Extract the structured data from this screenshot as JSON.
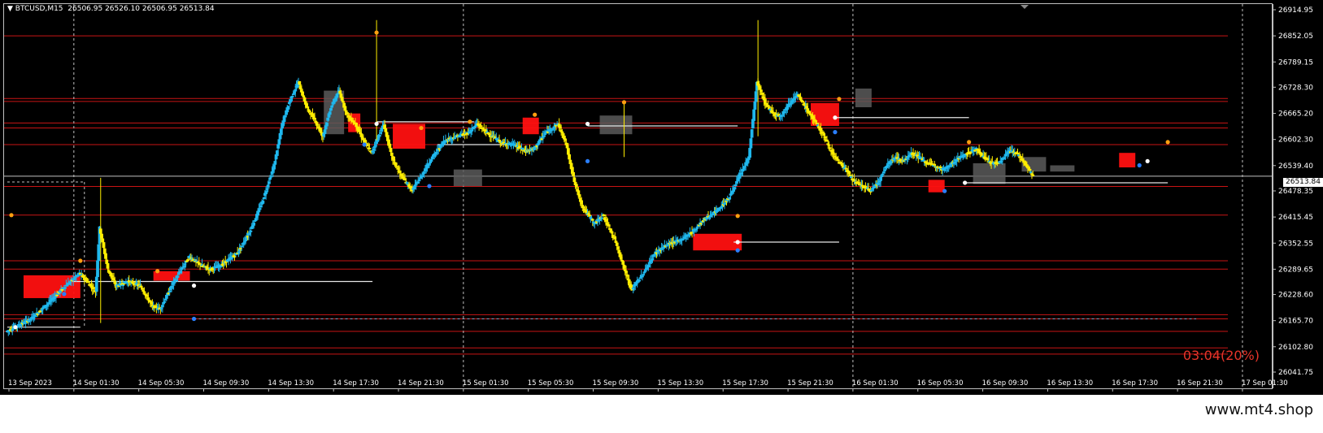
{
  "header": {
    "symbol": "BTCUSD,M15",
    "ohlc": "26506.95 26526.10 26506.95 26513.84"
  },
  "timer": "03:04(20%)",
  "brand": "www.mt4.shop",
  "last_price": "26513.84",
  "colors": {
    "background": "#000000",
    "bull": "#1fb8ee",
    "bear": "#ffee00",
    "level_line": "#c81414",
    "zone_red": "#ff1010",
    "zone_gray": "#5a5a5a",
    "grid": "#bfbfbf",
    "axis_text": "#ffffff",
    "timer": "#e8352a",
    "dot_orange": "#ff9f10",
    "dot_blue": "#2a7fff"
  },
  "chart_data": {
    "type": "candlestick",
    "title": "BTCUSD,M15",
    "ylim": [
      26041.75,
      26914.95
    ],
    "y_ticks": [
      "26914.95",
      "26852.05",
      "26789.15",
      "26728.30",
      "26665.20",
      "26602.30",
      "26539.40",
      "26478.35",
      "26415.45",
      "26352.55",
      "26289.65",
      "26228.60",
      "26165.70",
      "26102.80",
      "26041.75"
    ],
    "x_ticks": [
      "13 Sep 2023",
      "14 Sep 01:30",
      "14 Sep 05:30",
      "14 Sep 09:30",
      "14 Sep 13:30",
      "14 Sep 17:30",
      "14 Sep 21:30",
      "15 Sep 01:30",
      "15 Sep 05:30",
      "15 Sep 09:30",
      "15 Sep 13:30",
      "15 Sep 17:30",
      "15 Sep 21:30",
      "16 Sep 01:30",
      "16 Sep 05:30",
      "16 Sep 09:30",
      "16 Sep 13:30",
      "16 Sep 17:30",
      "16 Sep 21:30",
      "17 Sep 01:30"
    ],
    "grid_vertical_at": [
      "14 Sep 01:30",
      "15 Sep 01:30",
      "16 Sep 01:30",
      "17 Sep 01:30"
    ],
    "last_price": 26513.84,
    "price_path": [
      [
        0,
        26140
      ],
      [
        6,
        26170
      ],
      [
        10,
        26205
      ],
      [
        14,
        26245
      ],
      [
        18,
        26280
      ],
      [
        20,
        26260
      ],
      [
        22,
        26235
      ],
      [
        23,
        26390
      ],
      [
        25,
        26290
      ],
      [
        27,
        26250
      ],
      [
        30,
        26260
      ],
      [
        33,
        26250
      ],
      [
        36,
        26200
      ],
      [
        38,
        26195
      ],
      [
        41,
        26255
      ],
      [
        45,
        26320
      ],
      [
        48,
        26300
      ],
      [
        50,
        26290
      ],
      [
        53,
        26300
      ],
      [
        57,
        26330
      ],
      [
        60,
        26380
      ],
      [
        63,
        26450
      ],
      [
        66,
        26540
      ],
      [
        68,
        26640
      ],
      [
        70,
        26700
      ],
      [
        72,
        26740
      ],
      [
        74,
        26680
      ],
      [
        76,
        26650
      ],
      [
        78,
        26610
      ],
      [
        80,
        26680
      ],
      [
        82,
        26720
      ],
      [
        84,
        26660
      ],
      [
        86,
        26640
      ],
      [
        88,
        26600
      ],
      [
        90,
        26570
      ],
      [
        93,
        26640
      ],
      [
        95,
        26560
      ],
      [
        97,
        26520
      ],
      [
        100,
        26480
      ],
      [
        102,
        26510
      ],
      [
        105,
        26560
      ],
      [
        108,
        26600
      ],
      [
        111,
        26610
      ],
      [
        114,
        26620
      ],
      [
        116,
        26640
      ],
      [
        119,
        26615
      ],
      [
        122,
        26595
      ],
      [
        125,
        26590
      ],
      [
        128,
        26575
      ],
      [
        130,
        26580
      ],
      [
        133,
        26620
      ],
      [
        136,
        26640
      ],
      [
        138,
        26590
      ],
      [
        140,
        26500
      ],
      [
        142,
        26440
      ],
      [
        145,
        26400
      ],
      [
        147,
        26420
      ],
      [
        150,
        26360
      ],
      [
        152,
        26300
      ],
      [
        154,
        26240
      ],
      [
        157,
        26280
      ],
      [
        160,
        26330
      ],
      [
        163,
        26350
      ],
      [
        166,
        26360
      ],
      [
        169,
        26380
      ],
      [
        172,
        26410
      ],
      [
        175,
        26430
      ],
      [
        178,
        26460
      ],
      [
        181,
        26520
      ],
      [
        183,
        26560
      ],
      [
        185,
        26740
      ],
      [
        187,
        26690
      ],
      [
        189,
        26665
      ],
      [
        191,
        26660
      ],
      [
        193,
        26690
      ],
      [
        195,
        26710
      ],
      [
        197,
        26680
      ],
      [
        199,
        26650
      ],
      [
        201,
        26620
      ],
      [
        203,
        26580
      ],
      [
        205,
        26550
      ],
      [
        207,
        26530
      ],
      [
        209,
        26500
      ],
      [
        211,
        26490
      ],
      [
        213,
        26480
      ],
      [
        215,
        26500
      ],
      [
        217,
        26540
      ],
      [
        219,
        26560
      ],
      [
        221,
        26550
      ],
      [
        223,
        26570
      ],
      [
        225,
        26560
      ],
      [
        227,
        26545
      ],
      [
        229,
        26540
      ],
      [
        231,
        26530
      ],
      [
        233,
        26545
      ],
      [
        235,
        26560
      ],
      [
        237,
        26570
      ],
      [
        239,
        26580
      ],
      [
        241,
        26560
      ],
      [
        243,
        26545
      ],
      [
        245,
        26550
      ],
      [
        247,
        26575
      ],
      [
        249,
        26570
      ],
      [
        251,
        26545
      ],
      [
        253,
        26513.84
      ]
    ],
    "resistance_levels": [
      26852,
      26701,
      26694,
      26642,
      26630,
      26590,
      26489,
      26420,
      26310,
      26290,
      26180,
      26170,
      26140,
      26100,
      26085
    ],
    "zones": [
      {
        "color": "red",
        "x0": 4,
        "x1": 18,
        "y0": 26220,
        "y1": 26275
      },
      {
        "color": "red",
        "x0": 36,
        "x1": 45,
        "y0": 26262,
        "y1": 26285
      },
      {
        "color": "gray",
        "x0": 78,
        "x1": 83,
        "y0": 26615,
        "y1": 26720
      },
      {
        "color": "red",
        "x0": 84,
        "x1": 87,
        "y0": 26620,
        "y1": 26665
      },
      {
        "color": "red",
        "x0": 95,
        "x1": 103,
        "y0": 26580,
        "y1": 26640
      },
      {
        "color": "gray",
        "x0": 110,
        "x1": 117,
        "y0": 26490,
        "y1": 26530
      },
      {
        "color": "red",
        "x0": 127,
        "x1": 131,
        "y0": 26615,
        "y1": 26655
      },
      {
        "color": "gray",
        "x0": 146,
        "x1": 154,
        "y0": 26615,
        "y1": 26660
      },
      {
        "color": "red",
        "x0": 169,
        "x1": 181,
        "y0": 26335,
        "y1": 26375
      },
      {
        "color": "red",
        "x0": 198,
        "x1": 205,
        "y0": 26635,
        "y1": 26690
      },
      {
        "color": "gray",
        "x0": 209,
        "x1": 213,
        "y0": 26680,
        "y1": 26725
      },
      {
        "color": "red",
        "x0": 227,
        "x1": 231,
        "y0": 26475,
        "y1": 26505
      },
      {
        "color": "gray",
        "x0": 238,
        "x1": 246,
        "y0": 26495,
        "y1": 26545
      },
      {
        "color": "gray",
        "x0": 250,
        "x1": 256,
        "y0": 26525,
        "y1": 26560
      },
      {
        "color": "gray",
        "x0": 257,
        "x1": 263,
        "y0": 26525,
        "y1": 26540
      },
      {
        "color": "red",
        "x0": 274,
        "x1": 278,
        "y0": 26535,
        "y1": 26570
      }
    ],
    "white_lines": [
      {
        "x0": 0,
        "x1": 18,
        "y": 26150
      },
      {
        "x0": 16,
        "x1": 90,
        "y": 26260
      },
      {
        "x0": 91,
        "x1": 115,
        "y": 26645
      },
      {
        "x0": 106,
        "x1": 125,
        "y": 26590
      },
      {
        "x0": 143,
        "x1": 180,
        "y": 26635
      },
      {
        "x0": 179,
        "x1": 205,
        "y": 26355
      },
      {
        "x0": 204,
        "x1": 237,
        "y": 26655
      },
      {
        "x0": 236,
        "x1": 286,
        "y": 26498
      }
    ],
    "orange_dots": [
      [
        1,
        26420
      ],
      [
        18,
        26310
      ],
      [
        37,
        26285
      ],
      [
        91,
        26860
      ],
      [
        102,
        26630
      ],
      [
        114,
        26645
      ],
      [
        130,
        26662
      ],
      [
        152,
        26692
      ],
      [
        180,
        26418
      ],
      [
        205,
        26700
      ],
      [
        237,
        26596
      ],
      [
        286,
        26596
      ]
    ],
    "blue_dots": [
      [
        14,
        26230
      ],
      [
        46,
        26170
      ],
      [
        88,
        26590
      ],
      [
        104,
        26490
      ],
      [
        143,
        26550
      ],
      [
        180,
        26335
      ],
      [
        204,
        26620
      ],
      [
        231,
        26478
      ],
      [
        279,
        26540
      ]
    ],
    "white_dots": [
      [
        2,
        26150
      ],
      [
        46,
        26250
      ],
      [
        91,
        26640
      ],
      [
        143,
        26640
      ],
      [
        180,
        26355
      ],
      [
        204,
        26655
      ],
      [
        236,
        26498
      ],
      [
        281,
        26550
      ]
    ]
  }
}
